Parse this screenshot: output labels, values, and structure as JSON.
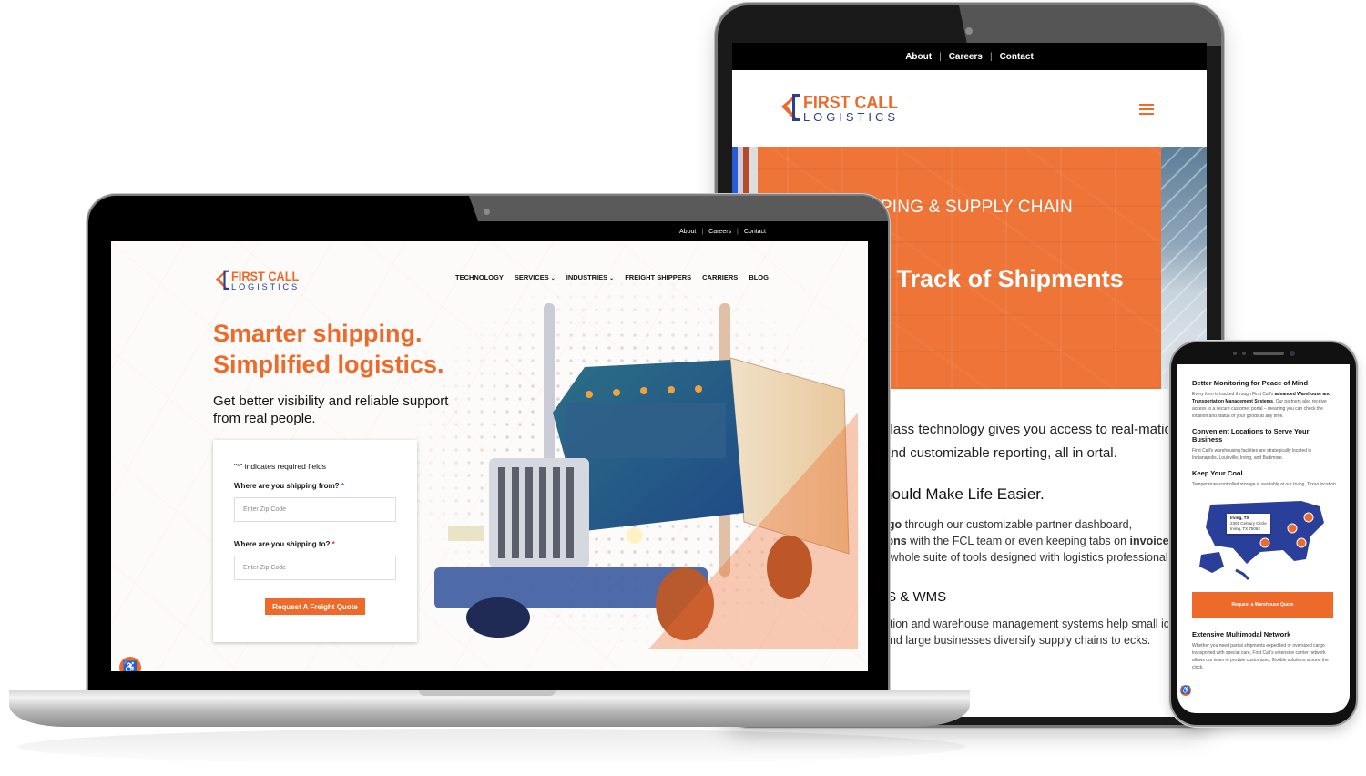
{
  "brand": {
    "name_top": "FIRST CALL",
    "name_bottom": "LOGISTICS",
    "accent_color": "#ee6a2a",
    "secondary_color": "#2a3f8f"
  },
  "tablet": {
    "utility_nav": [
      {
        "label": "About"
      },
      {
        "label": "Careers"
      },
      {
        "label": "Contact"
      }
    ],
    "separator": "|",
    "menu_icon": "hamburger-menu-icon",
    "hero": {
      "eyebrow": "PPING & SUPPLY CHAIN",
      "title": "e Track of Shipments"
    },
    "body": {
      "para1": "class technology gives you access to real-mation and customizable reporting, all in ortal.",
      "heading": "hould Make Life Easier.",
      "para2_bold1": "rgo",
      "para2_text1": " through our customizable partner dashboard,",
      "para2_bold2": "ions",
      "para2_text2": " with the FCL team or even keeping tabs on ",
      "para2_bold3": "invoice",
      "para2_text3": "r whole suite of tools designed with logistics professionals",
      "heading2": "IS & WMS",
      "para3": "ation and warehouse management systems help small ions and large businesses diversify supply chains to ecks."
    }
  },
  "laptop": {
    "utility_nav": [
      {
        "label": "About"
      },
      {
        "label": "Careers"
      },
      {
        "label": "Contact"
      }
    ],
    "separator": "|",
    "main_nav": [
      {
        "label": "TECHNOLOGY",
        "has_dropdown": false
      },
      {
        "label": "SERVICES",
        "has_dropdown": true
      },
      {
        "label": "INDUSTRIES",
        "has_dropdown": true
      },
      {
        "label": "FREIGHT SHIPPERS",
        "has_dropdown": false
      },
      {
        "label": "CARRIERS",
        "has_dropdown": false
      },
      {
        "label": "BLOG",
        "has_dropdown": false
      }
    ],
    "chevron": "⌄",
    "hero": {
      "title_line1": "Smarter shipping.",
      "title_line2": "Simplified logistics.",
      "subtitle": "Get better visibility and reliable support from real people."
    },
    "form": {
      "required_note": "\"*\" indicates required fields",
      "from_label": "Where are you shipping from?",
      "from_value": "",
      "from_placeholder": "Enter Zip Code",
      "to_label": "Where are you shipping to?",
      "to_value": "",
      "to_placeholder": "Enter Zip Code",
      "required_marker": "*",
      "submit_label": "Request A Freight Quote"
    },
    "accessibility_icon": "accessibility-icon"
  },
  "phone": {
    "sections": [
      {
        "heading": "Better Monitoring for Peace of Mind",
        "text_before": "Every item is tracked through First Call's ",
        "text_bold": "advanced Warehouse and Transportation Management Systems",
        "text_after": ". Our partners also receive access to a secure customer portal – meaning you can check the location and status of your goods at any time."
      },
      {
        "heading": "Convenient Locations to Serve Your Business",
        "text": "First Call's warehousing facilities are strategically located in Indianapolis, Louisville, Irving, and Baltimore."
      },
      {
        "heading": "Keep Your Cool",
        "text": "Temperature-controlled storage is available at our Irving, Texas location."
      }
    ],
    "map_tooltip": {
      "title": "Irving, TX",
      "line1": "2301 Century Circle",
      "line2": "Irving, TX 75062"
    },
    "warehouse_button": "Request a Warehouse Quote",
    "network": {
      "heading": "Extensive Multimodal Network",
      "text": "Whether you need partial shipments expedited or oversized cargo transported with special care, First Call's extensive carrier network allows our team to provide customized, flexible solutions around the clock."
    }
  }
}
